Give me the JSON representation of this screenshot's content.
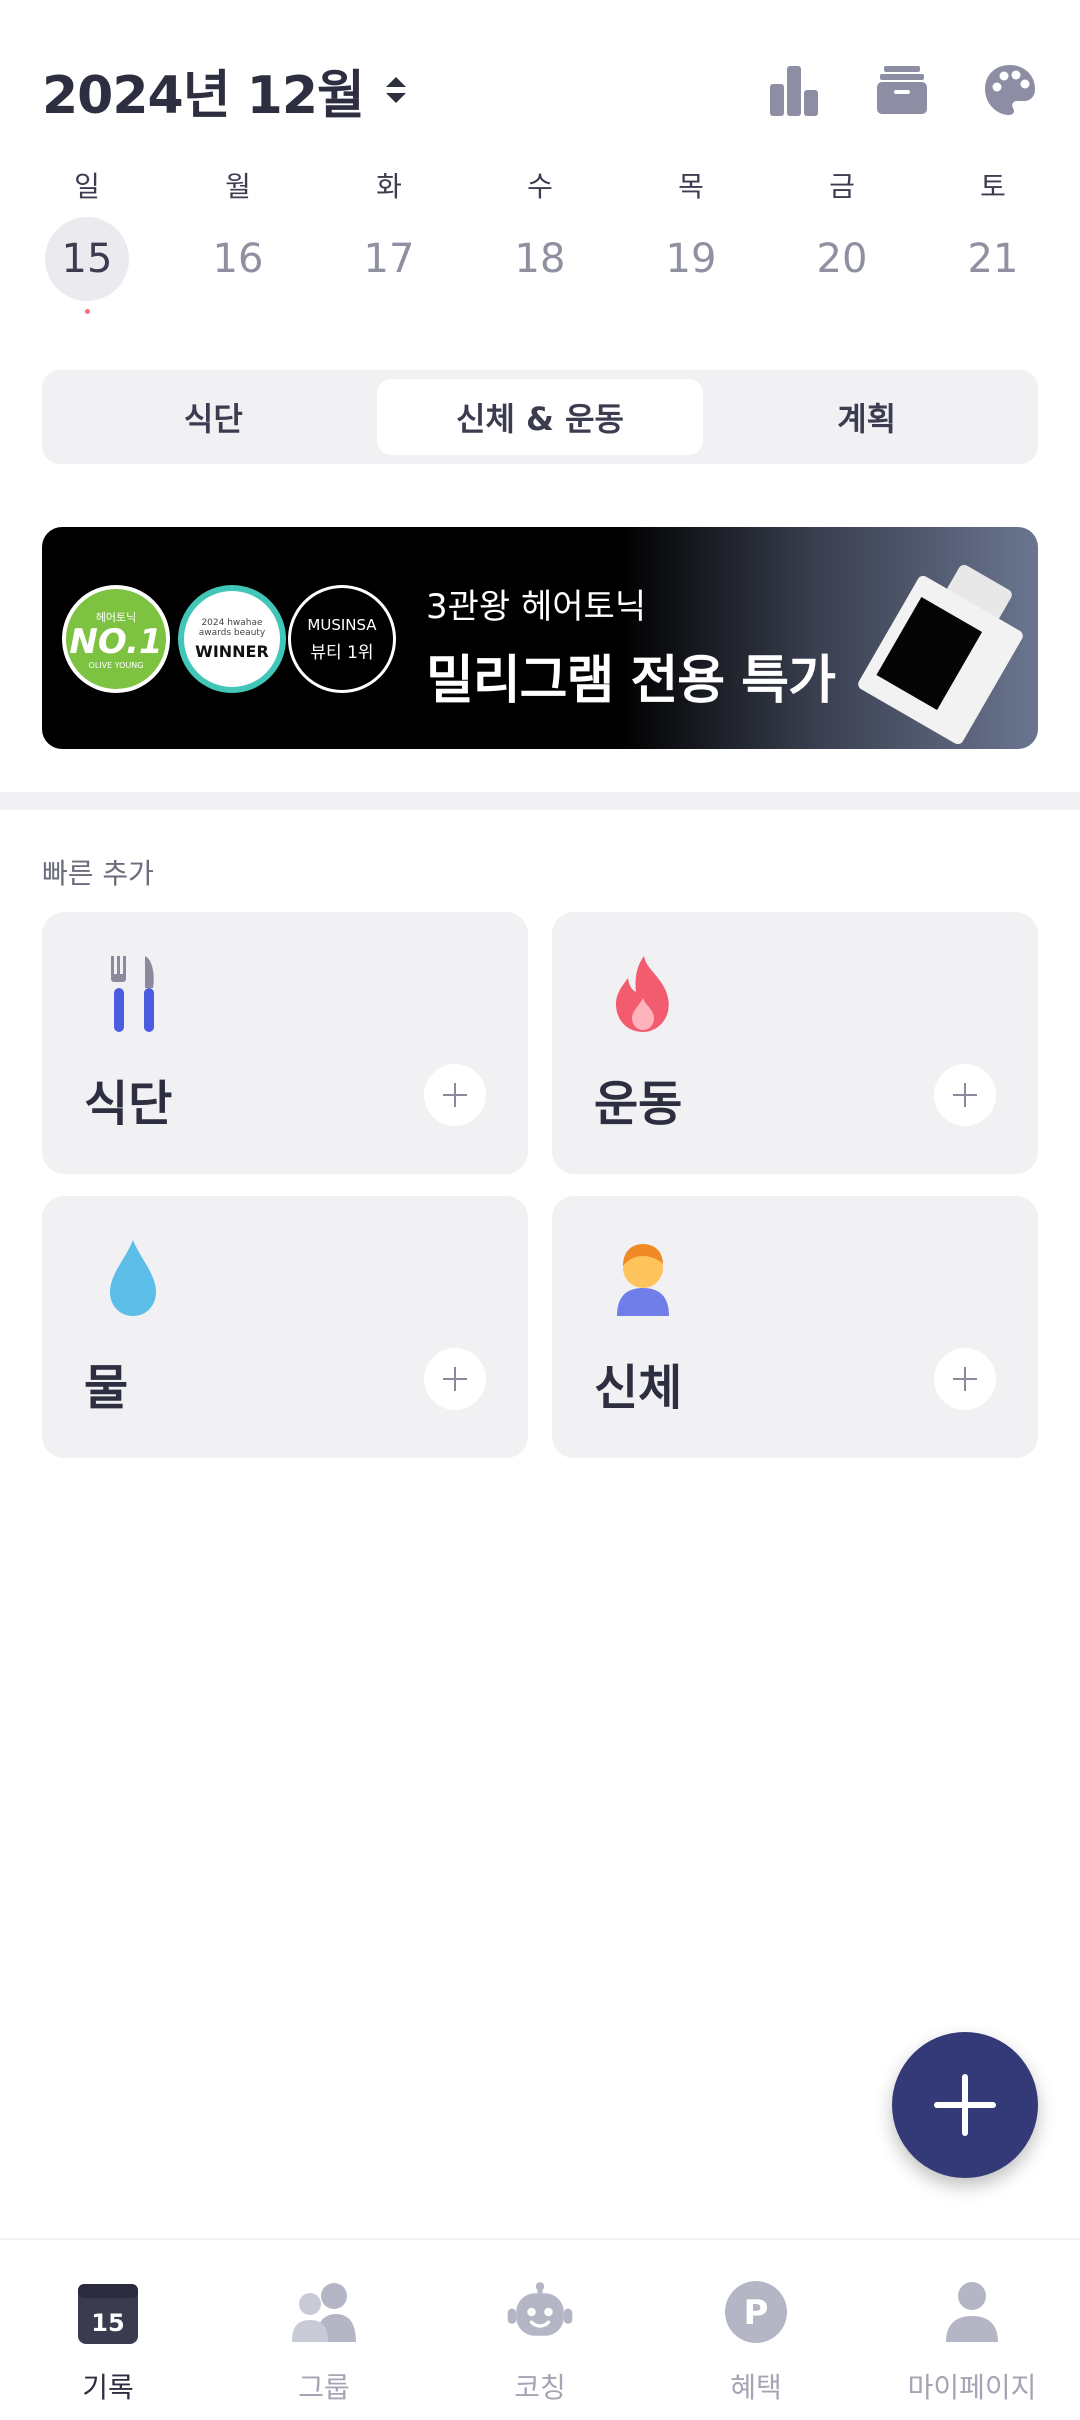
{
  "header": {
    "month_title": "2024년 12월",
    "icons": [
      "bar-chart-icon",
      "archive-icon",
      "palette-icon"
    ]
  },
  "week": {
    "days": [
      {
        "name": "일",
        "date": "15",
        "selected": true,
        "has_record": true
      },
      {
        "name": "월",
        "date": "16",
        "selected": false,
        "has_record": false
      },
      {
        "name": "화",
        "date": "17",
        "selected": false,
        "has_record": false
      },
      {
        "name": "수",
        "date": "18",
        "selected": false,
        "has_record": false
      },
      {
        "name": "목",
        "date": "19",
        "selected": false,
        "has_record": false
      },
      {
        "name": "금",
        "date": "20",
        "selected": false,
        "has_record": false
      },
      {
        "name": "토",
        "date": "21",
        "selected": false,
        "has_record": false
      }
    ]
  },
  "tabs": [
    {
      "label": "식단",
      "active": false
    },
    {
      "label": "신체 & 운동",
      "active": true
    },
    {
      "label": "계획",
      "active": false
    }
  ],
  "banner": {
    "badge1_top": "헤어토닉",
    "badge1_main": "NO.1",
    "badge1_bottom": "OLIVE YOUNG",
    "badge2_top": "2024 hwahae awards beauty",
    "badge2_main": "WINNER",
    "badge3_top": "MUSINSA",
    "badge3_bottom": "뷰티 1위",
    "subtitle": "3관왕 헤어토닉",
    "title": "밀리그램 전용 특가"
  },
  "quick_add": {
    "title": "빠른 추가",
    "cards": [
      {
        "label": "식단",
        "icon": "fork-knife-icon"
      },
      {
        "label": "운동",
        "icon": "fire-icon"
      },
      {
        "label": "물",
        "icon": "water-drop-icon"
      },
      {
        "label": "신체",
        "icon": "person-icon"
      }
    ]
  },
  "bottom_nav": [
    {
      "label": "기록",
      "icon": "calendar-icon",
      "badge": "15",
      "active": true
    },
    {
      "label": "그룹",
      "icon": "group-icon",
      "active": false
    },
    {
      "label": "코칭",
      "icon": "robot-icon",
      "active": false
    },
    {
      "label": "혜택",
      "icon": "points-icon",
      "badge": "P",
      "active": false
    },
    {
      "label": "마이페이지",
      "icon": "profile-icon",
      "active": false
    }
  ],
  "colors": {
    "primary": "#343a78",
    "text": "#2d2e40",
    "muted": "#a4a5b4",
    "card_bg": "#f1f1f4",
    "record_dot": "#ff6b81",
    "fire": "#f25c6e",
    "water": "#5bbde8",
    "utensil": "#4a5ce0"
  }
}
